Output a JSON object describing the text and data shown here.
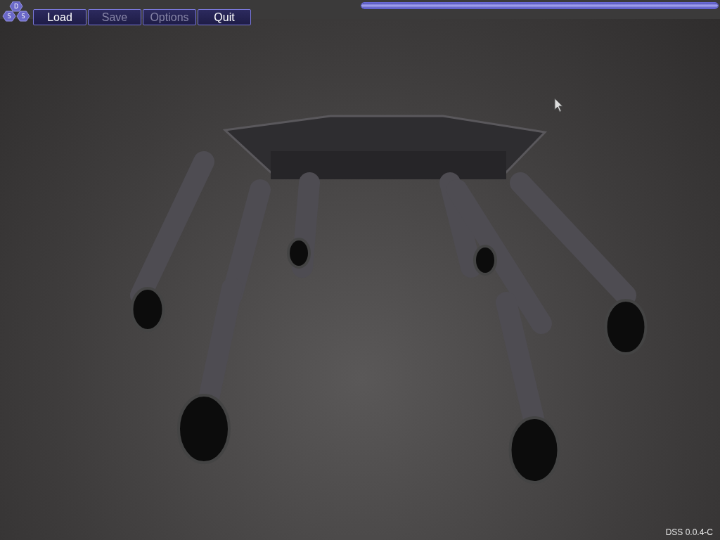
{
  "logo": {
    "letters": [
      "D",
      "S",
      "S"
    ]
  },
  "toolbar": {
    "buttons": [
      {
        "label": "Load",
        "disabled": false
      },
      {
        "label": "Save",
        "disabled": true
      },
      {
        "label": "Options",
        "disabled": true
      },
      {
        "label": "Quit",
        "disabled": false
      }
    ]
  },
  "progress": {
    "level": 1
  },
  "version": "DSS 0.0.4-C"
}
